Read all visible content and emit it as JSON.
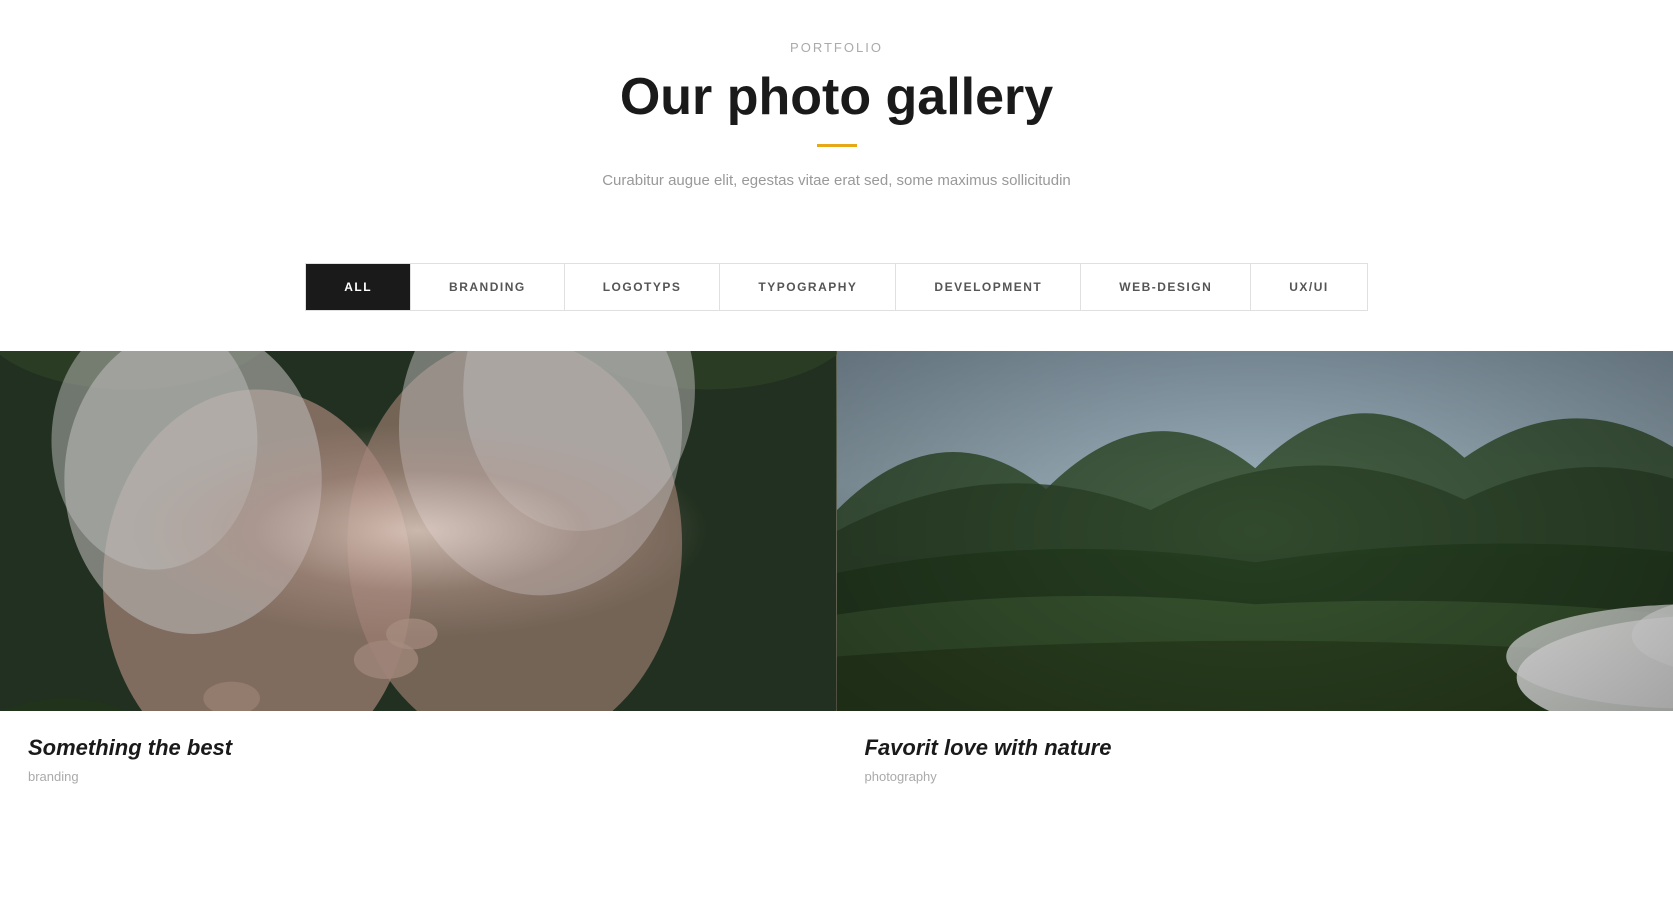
{
  "header": {
    "portfolio_label": "PORTFOLIO",
    "gallery_title": "Our photo gallery",
    "subtitle": "Curabitur augue elit, egestas vitae erat sed, some maximus sollicitudin"
  },
  "filter_tabs": [
    {
      "id": "all",
      "label": "ALL",
      "active": true
    },
    {
      "id": "branding",
      "label": "BRANDING",
      "active": false
    },
    {
      "id": "logotyps",
      "label": "LOGOTYPS",
      "active": false
    },
    {
      "id": "typography",
      "label": "TYPOGRAPHY",
      "active": false
    },
    {
      "id": "development",
      "label": "DEVELOPMENT",
      "active": false
    },
    {
      "id": "web-design",
      "label": "WEB-DESIGN",
      "active": false
    },
    {
      "id": "ux-ui",
      "label": "UX/UI",
      "active": false
    }
  ],
  "gallery_items": [
    {
      "id": "item1",
      "title": "Something the best",
      "category": "branding"
    },
    {
      "id": "item2",
      "title": "Favorit love with nature",
      "category": "photography"
    }
  ],
  "accent_color": "#e6a817"
}
